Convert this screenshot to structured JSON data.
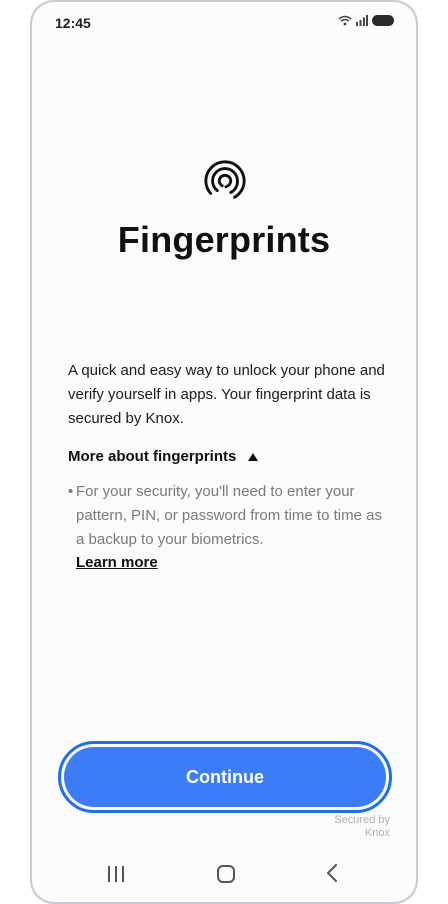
{
  "status_bar": {
    "time": "12:45"
  },
  "icon": "fingerprint-icon",
  "title": "Fingerprints",
  "description": "A quick and easy way to unlock your phone and verify yourself in apps. Your fingerprint data is secured by Knox.",
  "more_section": {
    "label": "More about fingerprints",
    "bullet": "For your security, you'll need to enter your pattern, PIN, or password from time to time as a backup to your biometrics.",
    "link": "Learn more"
  },
  "continue_label": "Continue",
  "secured_by": {
    "line1": "Secured by",
    "line2": "Knox"
  },
  "colors": {
    "accent": "#3c7cf6",
    "accent_border": "#1f6fe6"
  }
}
